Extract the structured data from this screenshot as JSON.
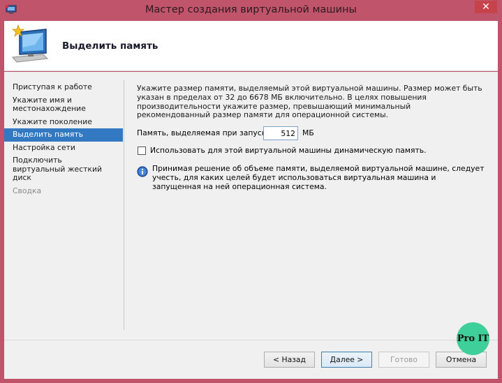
{
  "window": {
    "title": "Мастер создания виртуальной машины",
    "close_glyph": "✕"
  },
  "header": {
    "title": "Выделить память",
    "icon": "virtual-machine-monitor-icon"
  },
  "sidebar": {
    "items": [
      {
        "label": "Приступая к работе",
        "state": "normal"
      },
      {
        "label": "Укажите имя и местонахождение",
        "state": "normal"
      },
      {
        "label": "Укажите поколение",
        "state": "normal"
      },
      {
        "label": "Выделить память",
        "state": "active"
      },
      {
        "label": "Настройка сети",
        "state": "normal"
      },
      {
        "label": "Подключить виртуальный жесткий диск",
        "state": "normal"
      },
      {
        "label": "Сводка",
        "state": "disabled"
      }
    ]
  },
  "content": {
    "description": "Укажите размер памяти, выделяемый этой виртуальной машины. Размер может быть указан в пределах от 32 до 6678 МБ включительно. В целях повышения производительности укажите размер, превышающий минимальный рекомендованный размер памяти для операционной системы.",
    "memory_label": "Память, выделяемая при запуске:",
    "memory_value": "512",
    "memory_unit": "МБ",
    "dynamic_memory_label": "Использовать для этой виртуальной машины динамическую память.",
    "dynamic_memory_checked": false,
    "info_text": "Принимая решение об объеме памяти, выделяемой виртуальной машине, следует учесть, для каких целей будет использоваться виртуальная машина и запущенная на ней операционная система."
  },
  "footer": {
    "back_label": "< Назад",
    "next_label": "Далее >",
    "finish_label": "Готово",
    "cancel_label": "Отмена"
  },
  "watermark": {
    "text": "Pro IT"
  },
  "colors": {
    "titlebar": "#c0546b",
    "close_button": "#c7434c",
    "nav_active": "#3379c2",
    "badge": "#3fcf9a"
  }
}
